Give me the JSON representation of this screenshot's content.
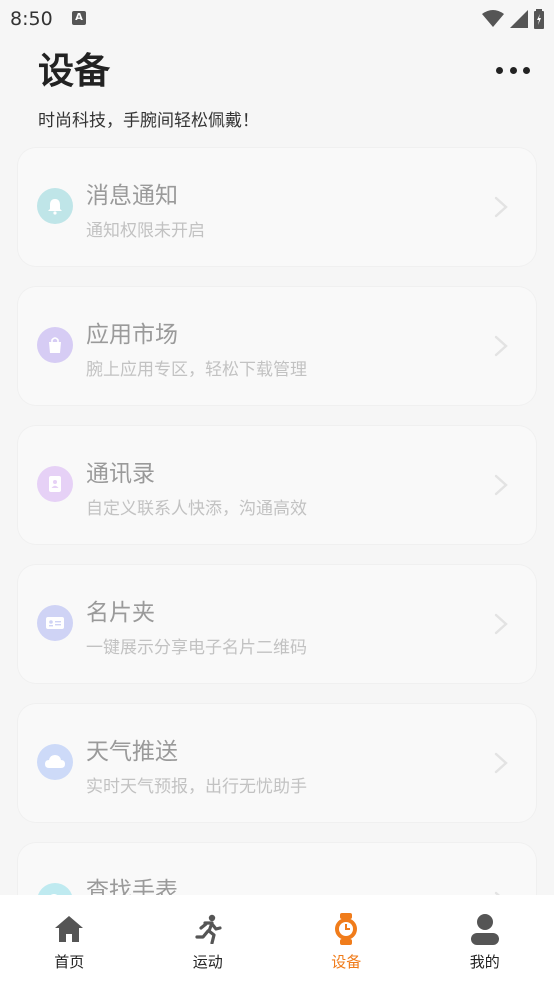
{
  "status": {
    "time": "8:50",
    "notification_glyph": "A"
  },
  "header": {
    "title": "设备",
    "subtitle": "时尚科技，手腕间轻松佩戴！"
  },
  "cards": [
    {
      "title": "消息通知",
      "desc": "通知权限未开启",
      "icon": "bell-icon",
      "color": "#bfe5e8"
    },
    {
      "title": "应用市场",
      "desc": "腕上应用专区，轻松下载管理",
      "icon": "shopping-bag-icon",
      "color": "#d6ccf4"
    },
    {
      "title": "通讯录",
      "desc": "自定义联系人快添，沟通高效",
      "icon": "contacts-icon",
      "color": "#e6d1f6"
    },
    {
      "title": "名片夹",
      "desc": "一键展示分享电子名片二维码",
      "icon": "business-card-icon",
      "color": "#cfd3f5"
    },
    {
      "title": "天气推送",
      "desc": "实时天气预报，出行无忧助手",
      "icon": "cloud-icon",
      "color": "#cddaf8"
    },
    {
      "title": "查找手表",
      "desc": "",
      "icon": "find-watch-icon",
      "color": "#bfeaf0"
    }
  ],
  "tabs": [
    {
      "label": "首页",
      "icon": "home-icon"
    },
    {
      "label": "运动",
      "icon": "running-icon"
    },
    {
      "label": "设备",
      "icon": "watch-icon",
      "active": true
    },
    {
      "label": "我的",
      "icon": "person-icon"
    }
  ],
  "colors": {
    "accent": "#f07c1b",
    "tab_inactive": "#555555"
  }
}
